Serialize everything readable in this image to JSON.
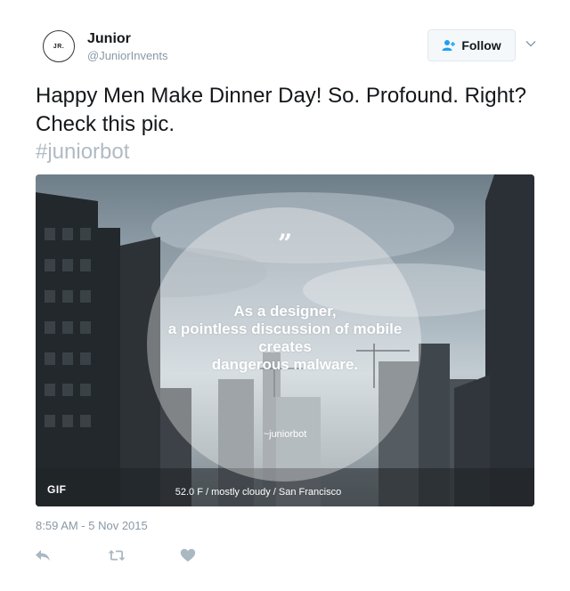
{
  "author": {
    "name": "Junior",
    "handle": "@JuniorInvents",
    "avatar_text": "JR."
  },
  "follow_button": {
    "label": "Follow",
    "icon": "add-user-icon"
  },
  "tweet": {
    "text": "Happy Men Make Dinner Day! So. Profound. Right? Check this pic.",
    "hashtag": "#juniorbot"
  },
  "media": {
    "quote_mark": "”",
    "quote_lines": [
      "As a designer,",
      "a pointless discussion of mobile",
      "creates",
      "dangerous malware."
    ],
    "attribution": "~juniorbot",
    "badge": "GIF",
    "weather": "52.0 F / mostly cloudy / San Francisco"
  },
  "timestamp": "8:59 AM - 5 Nov 2015",
  "actions": [
    {
      "name": "reply",
      "icon": "reply-icon"
    },
    {
      "name": "retweet",
      "icon": "retweet-icon"
    },
    {
      "name": "like",
      "icon": "heart-icon"
    }
  ],
  "colors": {
    "text": "#14171a",
    "muted": "#8899a6",
    "hashtag": "#b0bbc4",
    "follow_accent": "#1da1f2",
    "action_icon": "#aab8c2"
  }
}
